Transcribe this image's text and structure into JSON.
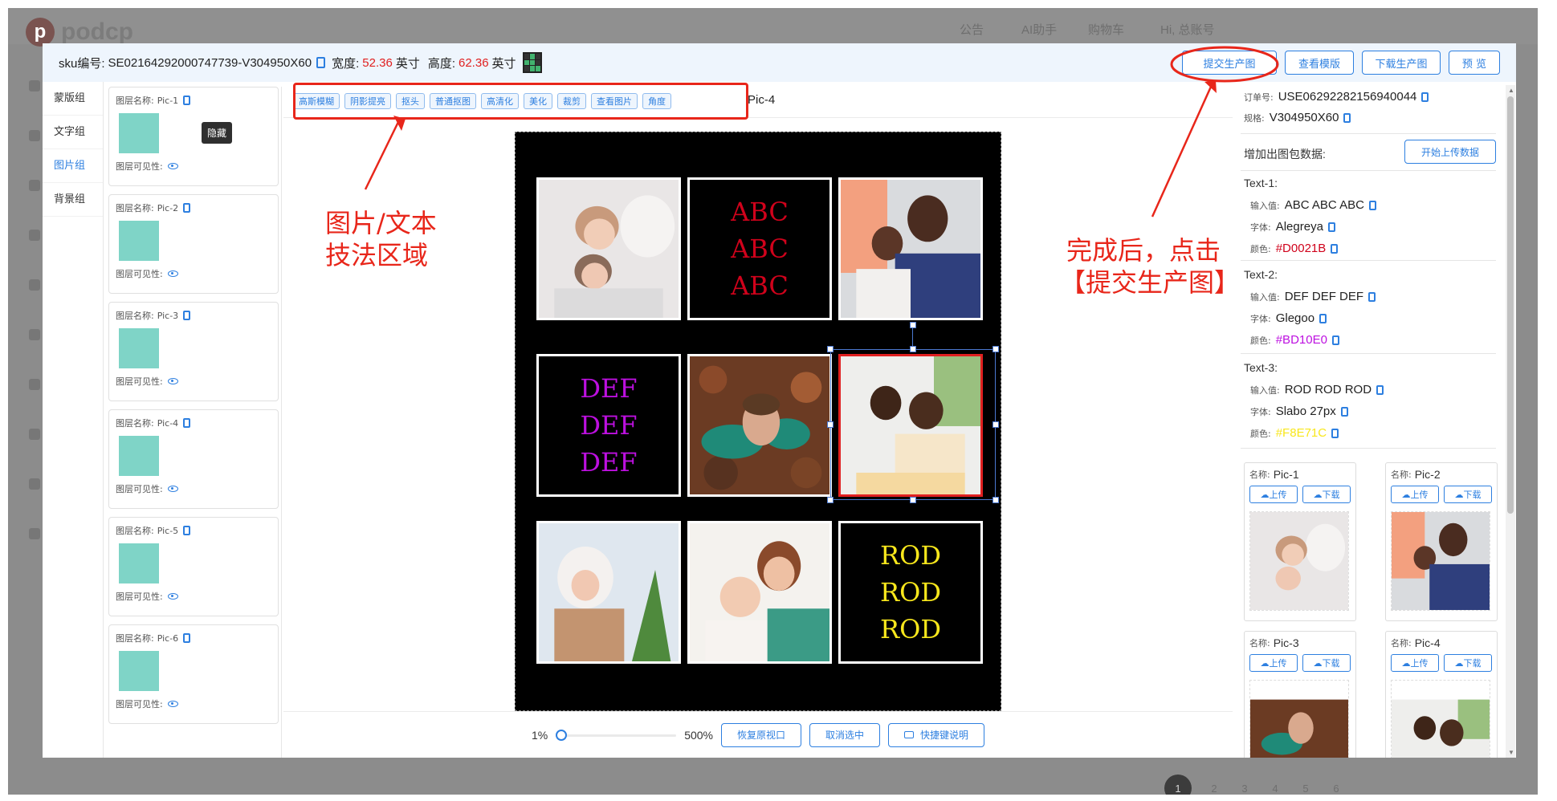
{
  "background_app": {
    "logo_text": "podcp",
    "nav": [
      "公告",
      "AI助手",
      "购物车",
      "Hi, 总账号"
    ],
    "pager": [
      "1",
      "2",
      "3",
      "4",
      "5",
      "6"
    ]
  },
  "header": {
    "sku_label": "sku编号:",
    "sku_value": "SE02164292000747739-V304950X60",
    "width_label": "宽度:",
    "width_value": "52.36",
    "width_unit": "英寸",
    "height_label": "高度:",
    "height_value": "62.36",
    "height_unit": "英寸",
    "buttons": {
      "submit": "提交生产图",
      "view_template": "查看模版",
      "download": "下载生产图",
      "preview": "预 览"
    }
  },
  "left_tabs": [
    "蒙版组",
    "文字组",
    "图片组",
    "背景组"
  ],
  "active_tab": "图片组",
  "layers": [
    {
      "name_label": "图层名称:",
      "name": "Pic-1",
      "visibility_label": "图层可见性:"
    },
    {
      "name_label": "图层名称:",
      "name": "Pic-2",
      "visibility_label": "图层可见性:"
    },
    {
      "name_label": "图层名称:",
      "name": "Pic-3",
      "visibility_label": "图层可见性:"
    },
    {
      "name_label": "图层名称:",
      "name": "Pic-4",
      "visibility_label": "图层可见性:"
    },
    {
      "name_label": "图层名称:",
      "name": "Pic-5",
      "visibility_label": "图层可见性:"
    },
    {
      "name_label": "图层名称:",
      "name": "Pic-6",
      "visibility_label": "图层可见性:"
    }
  ],
  "tooltip": "隐藏",
  "tools": [
    "高斯模糊",
    "阴影提亮",
    "抠头",
    "普通抠图",
    "高清化",
    "美化",
    "裁剪",
    "查看图片",
    "角度"
  ],
  "current_layer": "Pic-4",
  "artboard": {
    "texts": [
      {
        "lines": [
          "ABC",
          "ABC",
          "ABC"
        ],
        "color": "#D0021B"
      },
      {
        "lines": [
          "DEF",
          "DEF",
          "DEF"
        ],
        "color": "#BD10E0"
      },
      {
        "lines": [
          "ROD",
          "ROD",
          "ROD"
        ],
        "color": "#F8E71C"
      }
    ]
  },
  "zoom": {
    "min_label": "1%",
    "max_label": "500%",
    "value_fraction": 0.0,
    "buttons": [
      "恢复原视口",
      "取消选中",
      "快捷键说明"
    ]
  },
  "right_panel": {
    "order_label": "订单号:",
    "order_value": "USE06292282156940044",
    "spec_label": "规格:",
    "spec_value": "V304950X60",
    "add_data_label": "增加出图包数据:",
    "upload_data_button": "开始上传数据",
    "texts": [
      {
        "title": "Text-1:",
        "input_label": "输入值:",
        "input": "ABC ABC ABC",
        "font_label": "字体:",
        "font": "Alegreya",
        "color_label": "颜色:",
        "color": "#D0021B"
      },
      {
        "title": "Text-2:",
        "input_label": "输入值:",
        "input": "DEF DEF DEF",
        "font_label": "字体:",
        "font": "Glegoo",
        "color_label": "颜色:",
        "color": "#BD10E0"
      },
      {
        "title": "Text-3:",
        "input_label": "输入值:",
        "input": "ROD ROD ROD",
        "font_label": "字体:",
        "font": "Slabo 27px",
        "color_label": "颜色:",
        "color": "#F8E71C"
      }
    ],
    "pics": [
      {
        "name_label": "名称:",
        "name": "Pic-1",
        "upload": "上传",
        "download": "下载"
      },
      {
        "name_label": "名称:",
        "name": "Pic-2",
        "upload": "上传",
        "download": "下载"
      },
      {
        "name_label": "名称:",
        "name": "Pic-3",
        "upload": "上传",
        "download": "下载"
      },
      {
        "name_label": "名称:",
        "name": "Pic-4",
        "upload": "上传",
        "download": "下载"
      }
    ]
  },
  "annotations": {
    "left_text": [
      "图片/文本",
      "技法区域"
    ],
    "right_text": [
      "完成后，点击",
      "【提交生产图】"
    ],
    "color": "#E8261A"
  }
}
